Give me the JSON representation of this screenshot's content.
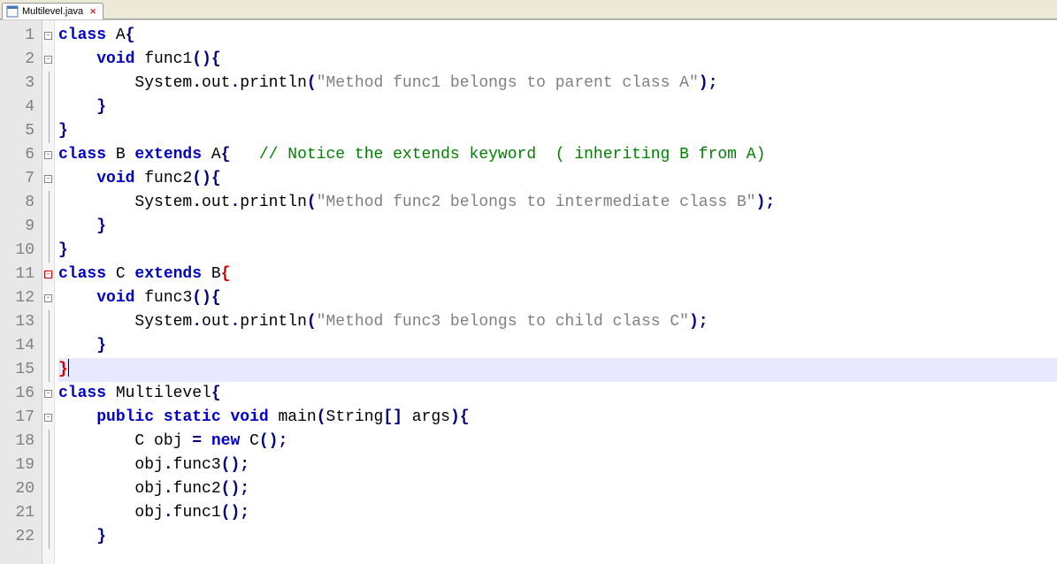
{
  "tab": {
    "filename": "Multilevel.java"
  },
  "gutter": {
    "start": 1,
    "end": 22
  },
  "highlighted_line": 15,
  "code_lines": [
    [
      {
        "cls": "kw",
        "t": "class"
      },
      {
        "cls": "ident",
        "t": " A"
      },
      {
        "cls": "punct",
        "t": "{"
      }
    ],
    [
      {
        "cls": "ident",
        "t": "    "
      },
      {
        "cls": "kw",
        "t": "void"
      },
      {
        "cls": "ident",
        "t": " func1"
      },
      {
        "cls": "punct",
        "t": "(){"
      }
    ],
    [
      {
        "cls": "ident",
        "t": "        System"
      },
      {
        "cls": "punct",
        "t": "."
      },
      {
        "cls": "ident",
        "t": "out"
      },
      {
        "cls": "punct",
        "t": "."
      },
      {
        "cls": "ident",
        "t": "println"
      },
      {
        "cls": "punct",
        "t": "("
      },
      {
        "cls": "str",
        "t": "\"Method func1 belongs to parent class A\""
      },
      {
        "cls": "punct",
        "t": ");"
      }
    ],
    [
      {
        "cls": "ident",
        "t": "    "
      },
      {
        "cls": "punct",
        "t": "}"
      }
    ],
    [
      {
        "cls": "punct",
        "t": "}"
      }
    ],
    [
      {
        "cls": "kw",
        "t": "class"
      },
      {
        "cls": "ident",
        "t": " B "
      },
      {
        "cls": "kw",
        "t": "extends"
      },
      {
        "cls": "ident",
        "t": " A"
      },
      {
        "cls": "punct",
        "t": "{"
      },
      {
        "cls": "ident",
        "t": "   "
      },
      {
        "cls": "cmt",
        "t": "// Notice the extends keyword  ( inheriting B from A)"
      }
    ],
    [
      {
        "cls": "ident",
        "t": "    "
      },
      {
        "cls": "kw",
        "t": "void"
      },
      {
        "cls": "ident",
        "t": " func2"
      },
      {
        "cls": "punct",
        "t": "(){"
      }
    ],
    [
      {
        "cls": "ident",
        "t": "        System"
      },
      {
        "cls": "punct",
        "t": "."
      },
      {
        "cls": "ident",
        "t": "out"
      },
      {
        "cls": "punct",
        "t": "."
      },
      {
        "cls": "ident",
        "t": "println"
      },
      {
        "cls": "punct",
        "t": "("
      },
      {
        "cls": "str",
        "t": "\"Method func2 belongs to intermediate class B\""
      },
      {
        "cls": "punct",
        "t": ");"
      }
    ],
    [
      {
        "cls": "ident",
        "t": "    "
      },
      {
        "cls": "punct",
        "t": "}"
      }
    ],
    [
      {
        "cls": "punct",
        "t": "}"
      }
    ],
    [
      {
        "cls": "kw",
        "t": "class"
      },
      {
        "cls": "ident",
        "t": " C "
      },
      {
        "cls": "kw",
        "t": "extends"
      },
      {
        "cls": "ident",
        "t": " B"
      },
      {
        "cls": "punct-red",
        "t": "{"
      }
    ],
    [
      {
        "cls": "ident",
        "t": "    "
      },
      {
        "cls": "kw",
        "t": "void"
      },
      {
        "cls": "ident",
        "t": " func3"
      },
      {
        "cls": "punct",
        "t": "(){"
      }
    ],
    [
      {
        "cls": "ident",
        "t": "        System"
      },
      {
        "cls": "punct",
        "t": "."
      },
      {
        "cls": "ident",
        "t": "out"
      },
      {
        "cls": "punct",
        "t": "."
      },
      {
        "cls": "ident",
        "t": "println"
      },
      {
        "cls": "punct",
        "t": "("
      },
      {
        "cls": "str",
        "t": "\"Method func3 belongs to child class C\""
      },
      {
        "cls": "punct",
        "t": ");"
      }
    ],
    [
      {
        "cls": "ident",
        "t": "    "
      },
      {
        "cls": "punct",
        "t": "}"
      }
    ],
    [
      {
        "cls": "punct-red",
        "t": "}"
      }
    ],
    [
      {
        "cls": "kw",
        "t": "class"
      },
      {
        "cls": "ident",
        "t": " Multilevel"
      },
      {
        "cls": "punct",
        "t": "{"
      }
    ],
    [
      {
        "cls": "ident",
        "t": "    "
      },
      {
        "cls": "kw",
        "t": "public"
      },
      {
        "cls": "ident",
        "t": " "
      },
      {
        "cls": "kw",
        "t": "static"
      },
      {
        "cls": "ident",
        "t": " "
      },
      {
        "cls": "kw",
        "t": "void"
      },
      {
        "cls": "ident",
        "t": " main"
      },
      {
        "cls": "punct",
        "t": "("
      },
      {
        "cls": "ident",
        "t": "String"
      },
      {
        "cls": "punct",
        "t": "[]"
      },
      {
        "cls": "ident",
        "t": " args"
      },
      {
        "cls": "punct",
        "t": "){"
      }
    ],
    [
      {
        "cls": "ident",
        "t": "        C obj "
      },
      {
        "cls": "punct",
        "t": "="
      },
      {
        "cls": "ident",
        "t": " "
      },
      {
        "cls": "kw",
        "t": "new"
      },
      {
        "cls": "ident",
        "t": " C"
      },
      {
        "cls": "punct",
        "t": "();"
      }
    ],
    [
      {
        "cls": "ident",
        "t": "        obj"
      },
      {
        "cls": "punct",
        "t": "."
      },
      {
        "cls": "ident",
        "t": "func3"
      },
      {
        "cls": "punct",
        "t": "();"
      }
    ],
    [
      {
        "cls": "ident",
        "t": "        obj"
      },
      {
        "cls": "punct",
        "t": "."
      },
      {
        "cls": "ident",
        "t": "func2"
      },
      {
        "cls": "punct",
        "t": "();"
      }
    ],
    [
      {
        "cls": "ident",
        "t": "        obj"
      },
      {
        "cls": "punct",
        "t": "."
      },
      {
        "cls": "ident",
        "t": "func1"
      },
      {
        "cls": "punct",
        "t": "();"
      }
    ],
    [
      {
        "cls": "ident",
        "t": "    "
      },
      {
        "cls": "punct",
        "t": "}"
      }
    ]
  ],
  "fold_markers": {
    "1": "box",
    "2": "box",
    "6": "box",
    "7": "box",
    "11": "box-red",
    "12": "box",
    "16": "box",
    "17": "box"
  }
}
